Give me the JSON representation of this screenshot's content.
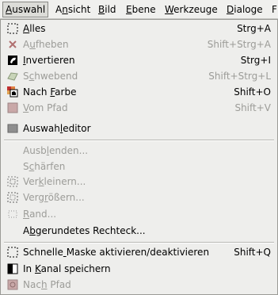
{
  "menubar": {
    "items": [
      {
        "label": "Auswahl",
        "mn": 0
      },
      {
        "label": "Ansicht",
        "mn": 1
      },
      {
        "label": "Bild",
        "mn": 0
      },
      {
        "label": "Ebene",
        "mn": 0
      },
      {
        "label": "Werkzeuge",
        "mn": 0
      },
      {
        "label": "Dialoge",
        "mn": 0
      },
      {
        "label": "F",
        "mn": -1
      }
    ]
  },
  "menu": {
    "items": [
      {
        "label": "Alles",
        "mn": 0,
        "shortcut": "Strg+A",
        "enabled": true,
        "icon": "select-all-icon"
      },
      {
        "label": "Aufheben",
        "mn": 1,
        "shortcut": "Shift+Strg+A",
        "enabled": false,
        "icon": "select-none-icon"
      },
      {
        "label": "Invertieren",
        "mn": 0,
        "shortcut": "Strg+I",
        "enabled": true,
        "icon": "invert-selection-icon"
      },
      {
        "label": "Schwebend",
        "mn": 1,
        "shortcut": "Shift+Strg+L",
        "enabled": false,
        "icon": "floating-selection-icon"
      },
      {
        "label": "Nach Farbe",
        "mn": 5,
        "shortcut": "Shift+O",
        "enabled": true,
        "icon": "select-by-color-icon"
      },
      {
        "label": "Vom Pfad",
        "mn": 0,
        "shortcut": "Shift+V",
        "enabled": false,
        "icon": "selection-from-path-icon"
      },
      {
        "label": "Auswahleditor",
        "mn": 6,
        "shortcut": "",
        "enabled": true,
        "icon": "selection-editor-icon"
      },
      {
        "label": "Ausblenden...",
        "mn": 4,
        "shortcut": "",
        "enabled": false,
        "icon": ""
      },
      {
        "label": "Schärfen",
        "mn": 1,
        "shortcut": "",
        "enabled": false,
        "icon": ""
      },
      {
        "label": "Verkleinern...",
        "mn": 3,
        "shortcut": "",
        "enabled": false,
        "icon": "shrink-selection-icon"
      },
      {
        "label": "Vergrößern...",
        "mn": 4,
        "shortcut": "",
        "enabled": false,
        "icon": "grow-selection-icon"
      },
      {
        "label": "Rand...",
        "mn": 0,
        "shortcut": "",
        "enabled": false,
        "icon": "border-selection-icon"
      },
      {
        "label": "Abgerundetes Rechteck...",
        "mn": 1,
        "shortcut": "",
        "enabled": true,
        "icon": ""
      },
      {
        "label": "Schnelle Maske aktivieren/deaktivieren",
        "mn": 8,
        "shortcut": "Shift+Q",
        "enabled": true,
        "icon": "quick-mask-toggle-icon"
      },
      {
        "label": "In Kanal speichern",
        "mn": 3,
        "shortcut": "",
        "enabled": true,
        "icon": "save-to-channel-icon"
      },
      {
        "label": "Nach Pfad",
        "mn": 3,
        "shortcut": "",
        "enabled": false,
        "icon": "selection-to-path-icon"
      }
    ]
  }
}
